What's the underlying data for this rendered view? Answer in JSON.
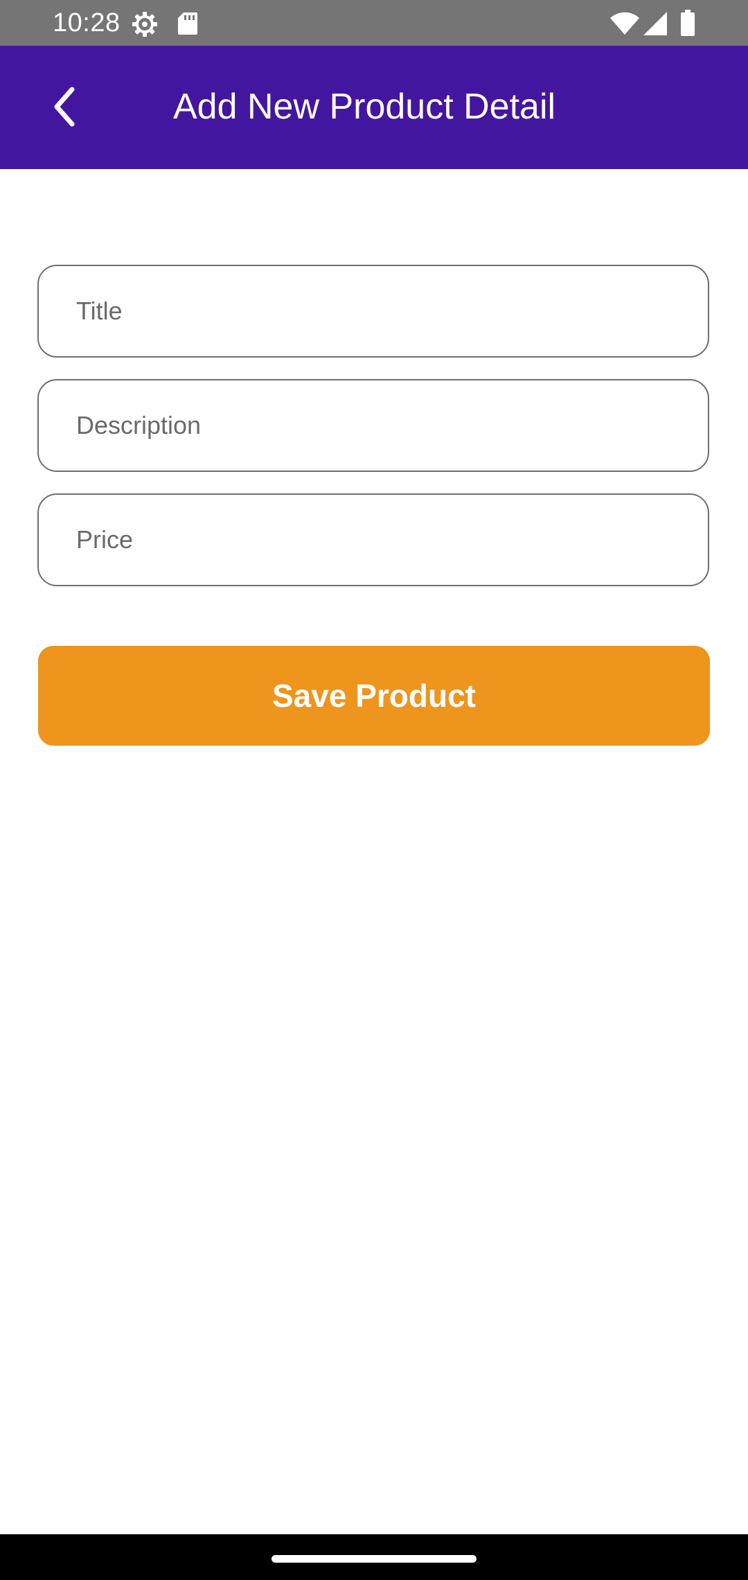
{
  "status_bar": {
    "time": "10:28",
    "icons": [
      "settings-icon",
      "sd-card-icon",
      "wifi-icon",
      "signal-icon",
      "battery-icon"
    ]
  },
  "app_bar": {
    "title": "Add New Product Detail",
    "back_icon": "chevron-left-icon",
    "background_color": "#43169f"
  },
  "form": {
    "fields": [
      {
        "name": "title",
        "placeholder": "Title",
        "value": ""
      },
      {
        "name": "description",
        "placeholder": "Description",
        "value": ""
      },
      {
        "name": "price",
        "placeholder": "Price",
        "value": ""
      }
    ],
    "save_label": "Save Product",
    "save_color": "#ed951c"
  }
}
